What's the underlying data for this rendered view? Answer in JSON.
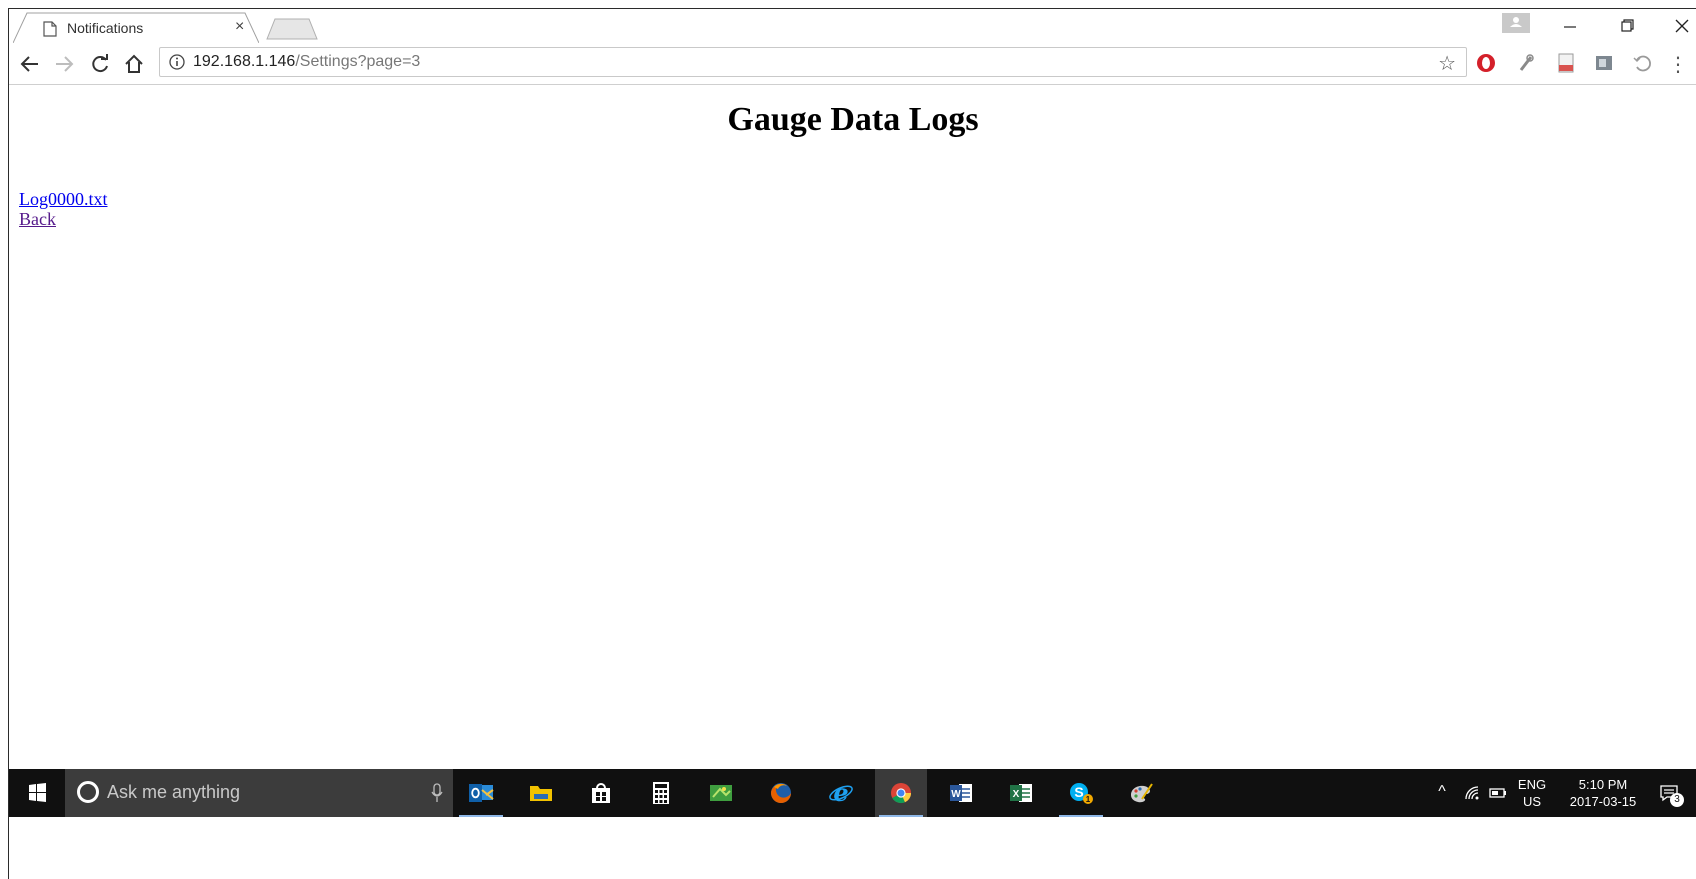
{
  "browser": {
    "tab": {
      "title": "Notifications",
      "close_glyph": "×",
      "icon": "page-icon"
    },
    "window_controls": {
      "minimize_glyph": "—",
      "close_glyph": "✕"
    },
    "url": {
      "host": "192.168.1.146",
      "path": "/Settings?page=3"
    },
    "bookmark_glyph": "☆",
    "extensions": [
      "opera-red-icon",
      "pen-icon",
      "pdf-icon",
      "screenshot-icon",
      "history-icon"
    ],
    "menu_glyph": "⋮"
  },
  "page": {
    "heading": "Gauge Data Logs",
    "links": [
      {
        "label": "Log0000.txt"
      },
      {
        "label": "Back"
      }
    ]
  },
  "taskbar": {
    "search_placeholder": "Ask me anything",
    "apps": [
      "outlook-icon",
      "file-explorer-icon",
      "store-icon",
      "calculator-icon",
      "game-icon",
      "firefox-icon",
      "ie-icon",
      "chrome-icon",
      "word-icon",
      "excel-icon",
      "skype-icon",
      "paint-icon"
    ],
    "tray": {
      "chevron": "^",
      "language": "ENG",
      "region": "US",
      "time": "5:10 PM",
      "date": "2017-03-15",
      "notification_count": "3"
    }
  },
  "colors": {
    "taskbar_bg": "#101010",
    "search_bg": "#3c3c3c",
    "link": "#0000ee",
    "visited_link": "#551a8b"
  }
}
